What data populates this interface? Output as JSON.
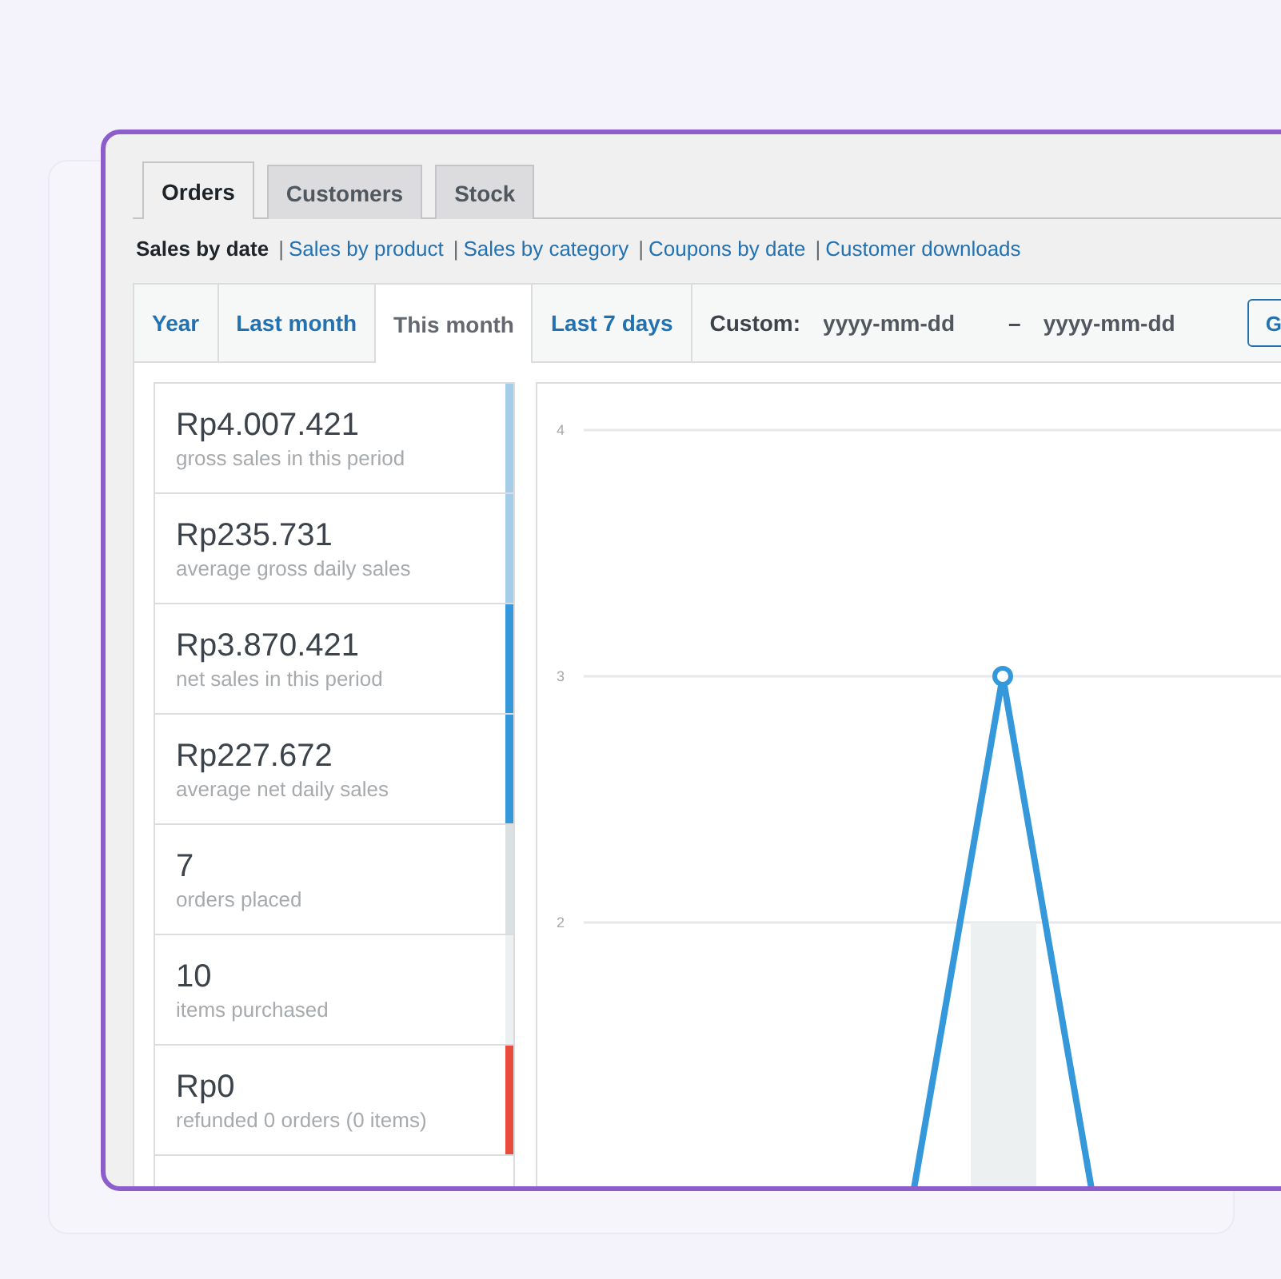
{
  "tabs": [
    {
      "label": "Orders",
      "selected": true
    },
    {
      "label": "Customers",
      "selected": false
    },
    {
      "label": "Stock",
      "selected": false
    }
  ],
  "subnav": [
    {
      "label": "Sales by date",
      "selected": true
    },
    {
      "separator": "|",
      "label": "Sales by product",
      "selected": false
    },
    {
      "separator": "|",
      "label": "Sales by category",
      "selected": false
    },
    {
      "separator": "|",
      "label": "Coupons by date",
      "selected": false
    },
    {
      "separator": "|",
      "label": "Customer downloads",
      "selected": false
    }
  ],
  "ranges": [
    {
      "label": "Year",
      "selected": false
    },
    {
      "label": "Last month",
      "selected": false
    },
    {
      "label": "This month",
      "selected": true
    },
    {
      "label": "Last 7 days",
      "selected": false
    }
  ],
  "custom": {
    "label": "Custom:",
    "from_placeholder": "yyyy-mm-dd",
    "separator": "–",
    "to_placeholder": "yyyy-mm-dd",
    "button": "G"
  },
  "legend": [
    {
      "value": "Rp4.007.421",
      "label": "gross sales in this period",
      "color": "#a3cde9"
    },
    {
      "value": "Rp235.731",
      "label": "average gross daily sales",
      "color": "#a3cde9"
    },
    {
      "value": "Rp3.870.421",
      "label": "net sales in this period",
      "color": "#3498db"
    },
    {
      "value": "Rp227.672",
      "label": "average net daily sales",
      "color": "#3498db"
    },
    {
      "value": "7",
      "label": "orders placed",
      "color": "#dbe1e3"
    },
    {
      "value": "10",
      "label": "items purchased",
      "color": "#ecf0f1"
    },
    {
      "value": "Rp0",
      "label": "refunded 0 orders (0 items)",
      "color": "#e74c3c"
    }
  ],
  "chart": {
    "y_axis_labels": [
      "4",
      "3",
      "2"
    ]
  }
}
